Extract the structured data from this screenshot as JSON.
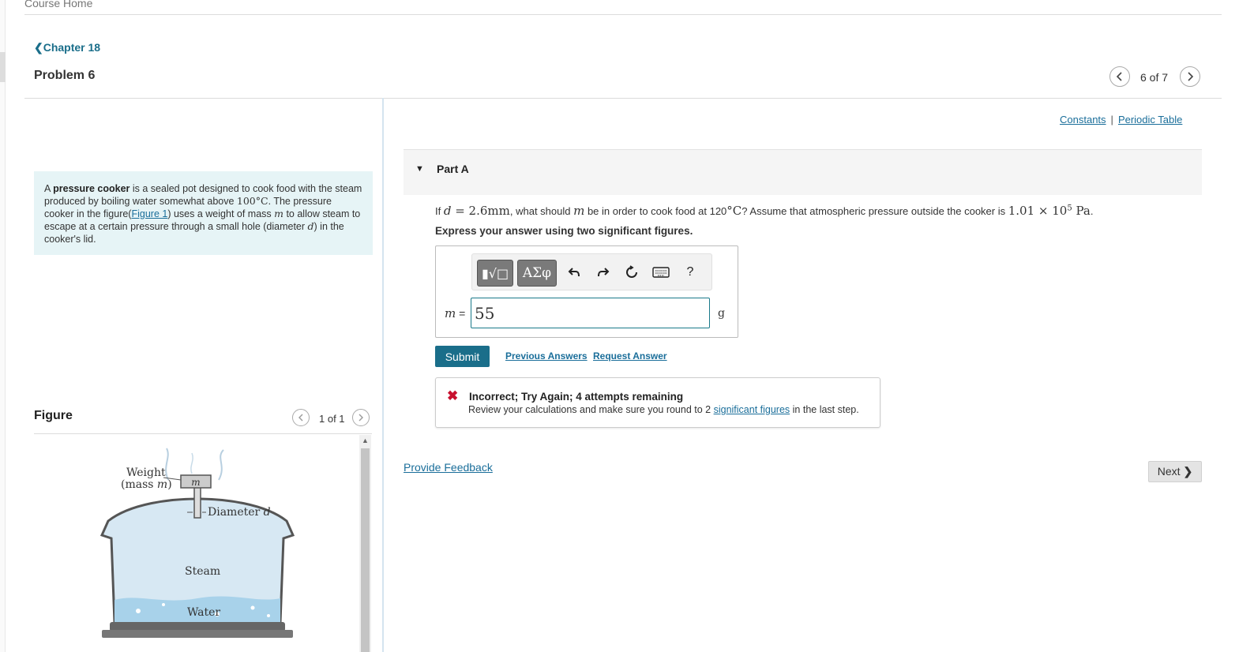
{
  "nav": {
    "course_home": "Course Home",
    "chapter_link": "Chapter 18",
    "problem_title": "Problem 6",
    "position": "6 of 7"
  },
  "problem": {
    "t1": "A ",
    "bold_term": "pressure cooker",
    "t2": " is a sealed pot designed to cook food with the steam produced by boiling water somewhat above ",
    "temp": "100°C",
    "t3": ". The pressure cooker in the figure(",
    "figure_link": "Figure 1",
    "t4": ") uses a weight of mass ",
    "mass_var": "m",
    "t5": " to allow steam to escape at a certain pressure through a small hole (diameter ",
    "diam_var": "d",
    "t6": ") in the cooker's lid."
  },
  "figure": {
    "title": "Figure",
    "count": "1 of 1",
    "labels": {
      "weight": "Weight",
      "mass_prefix": "(mass ",
      "mass_var": "m",
      "mass_suffix": ")",
      "weight_var": "m",
      "diameter": "Diameter ",
      "diameter_var": "d",
      "steam": "Steam",
      "water": "Water"
    },
    "colors": {
      "pot_outline": "#555555",
      "steam": "#cfe4f1",
      "water": "#a8d2ea"
    }
  },
  "links": {
    "constants": "Constants",
    "separator": "|",
    "periodic_table": "Periodic Table"
  },
  "part": {
    "label": "Part A",
    "q1": "If ",
    "q_d": "d",
    "q_dval": " = 2.6mm",
    "q2": ", what should ",
    "q_m": "m",
    "q3": " be in order to cook food at 120",
    "q_deg": "°C",
    "q4": "? Assume that atmospheric pressure outside the cooker is ",
    "q_pressure": "1.01 × 10",
    "q_exp": "5",
    "q_unit": " Pa",
    "q5": ".",
    "instruction": "Express your answer using two significant figures."
  },
  "answer": {
    "var": "m",
    "equals": " =",
    "value": "55",
    "unit": "g",
    "toolbar": {
      "templates": "▮√□",
      "greek": "ΑΣφ",
      "help": "?"
    }
  },
  "actions": {
    "submit": "Submit",
    "previous_answers": "Previous Answers",
    "request_answer": "Request Answer"
  },
  "feedback": {
    "title": "Incorrect; Try Again; 4 attempts remaining",
    "t1": "Review your calculations and make sure you round to 2 ",
    "link": "significant figures",
    "t2": " in the last step.",
    "color": "#c8102e"
  },
  "footer": {
    "provide_feedback": "Provide Feedback",
    "next": "Next"
  }
}
